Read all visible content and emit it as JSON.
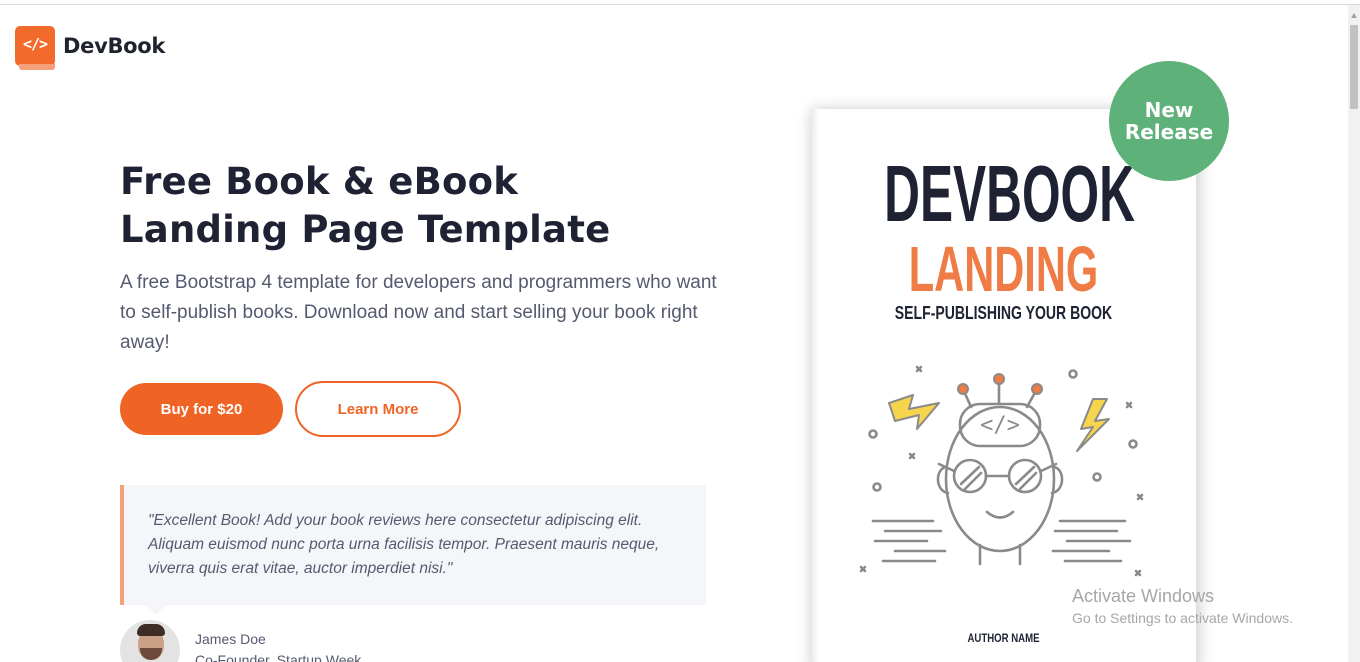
{
  "brand": {
    "name": "DevBook",
    "logo_glyph": "</>",
    "logo_color": "#f26a2c"
  },
  "hero": {
    "title_line1": "Free Book & eBook",
    "title_line2": "Landing Page Template",
    "intro": "A free Bootstrap 4 template for developers and programmers who want to self-publish books. Download now and start selling your book right away!",
    "buy_label": "Buy for $20",
    "learn_label": "Learn More"
  },
  "testimonial": {
    "quote": "\"Excellent Book! Add your book reviews here consectetur adipiscing elit. Aliquam euismod nunc porta urna facilisis tempor. Praesent mauris neque, viverra quis erat vitae, auctor imperdiet nisi.\"",
    "author_name": "James Doe",
    "author_role": "Co-Founder, Startup Week"
  },
  "book": {
    "title_line1": "DEVBOOK",
    "title_line2": "LANDING",
    "subtitle": "SELF-PUBLISHING YOUR BOOK",
    "author": "AUTHOR NAME",
    "illustration_glyph": "</>"
  },
  "badge": {
    "line1": "New",
    "line2": "Release",
    "color": "#5fb17a"
  },
  "watermark": {
    "title": "Activate Windows",
    "subtitle": "Go to Settings to activate Windows."
  },
  "colors": {
    "accent": "#ef6425",
    "heading": "#1e2233",
    "body_text": "#555a70"
  }
}
